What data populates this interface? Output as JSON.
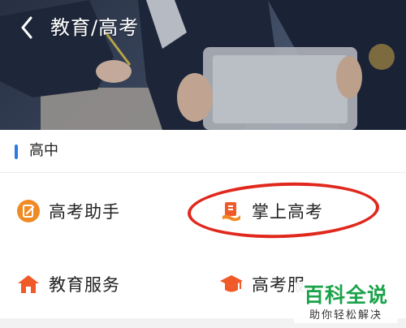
{
  "header": {
    "title": "教育/高考",
    "back_icon": "chevron-left-icon"
  },
  "section": {
    "title": "高中",
    "accent_color": "#2c7be5"
  },
  "items": [
    {
      "label": "高考助手",
      "icon": "edit-note-icon",
      "icon_color": "#f08a24"
    },
    {
      "label": "掌上高考",
      "icon": "book-hand-icon",
      "icon_color": "#f05a28"
    },
    {
      "label": "教育服务",
      "icon": "school-house-icon",
      "icon_color": "#f05a28"
    },
    {
      "label": "高考服",
      "icon": "graduation-cap-icon",
      "icon_color": "#f05a28"
    }
  ],
  "annotation": {
    "highlight_color": "#e0281d"
  },
  "watermark": {
    "main": "百科全说",
    "sub": "助你轻松解决",
    "color": "#1aa34a"
  }
}
